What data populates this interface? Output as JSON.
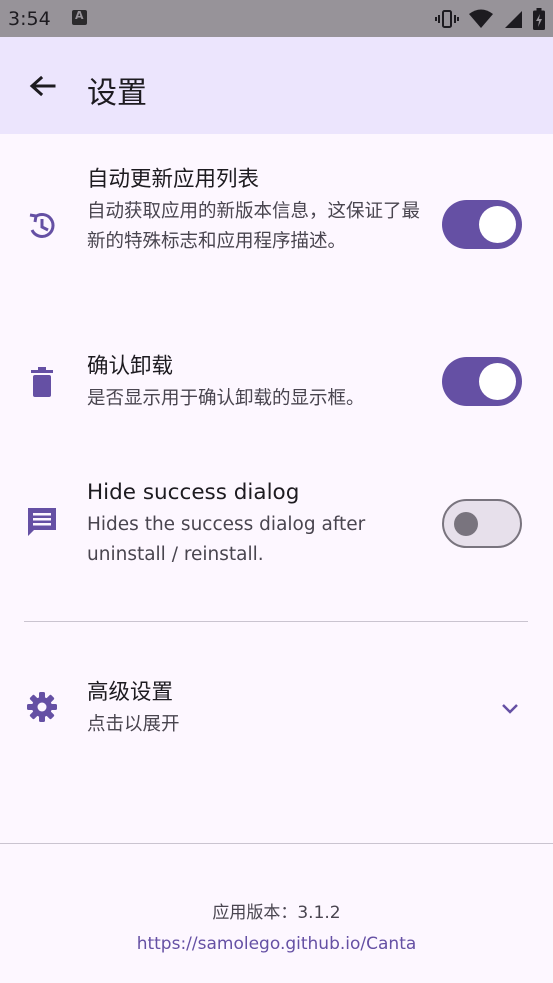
{
  "status_bar": {
    "time": "3:54",
    "icons": [
      "notification-a-icon",
      "vibrate-icon",
      "wifi-icon",
      "signal-icon",
      "battery-icon"
    ]
  },
  "app_bar": {
    "title": "设置",
    "back_icon": "arrow-back-icon"
  },
  "settings": [
    {
      "icon": "update-history-icon",
      "title": "自动更新应用列表",
      "description": "自动获取应用的新版本信息，这保证了最新的特殊标志和应用程序描述。",
      "enabled": true
    },
    {
      "icon": "trash-icon",
      "title": "确认卸载",
      "description": "是否显示用于确认卸载的显示框。",
      "enabled": true
    },
    {
      "icon": "message-icon",
      "title": "Hide success dialog",
      "description": "Hides the success dialog after uninstall / reinstall.",
      "enabled": false
    }
  ],
  "advanced": {
    "icon": "gear-icon",
    "title": "高级设置",
    "subtitle": "点击以展开",
    "expand_icon": "chevron-down-icon"
  },
  "footer": {
    "version": "应用版本：3.1.2",
    "link": "https://samolego.github.io/Canta"
  },
  "colors": {
    "primary": "#6550a4",
    "app_bar_bg": "#ece5fd",
    "background": "#fdf7ff",
    "status_bar_bg": "#979399"
  }
}
